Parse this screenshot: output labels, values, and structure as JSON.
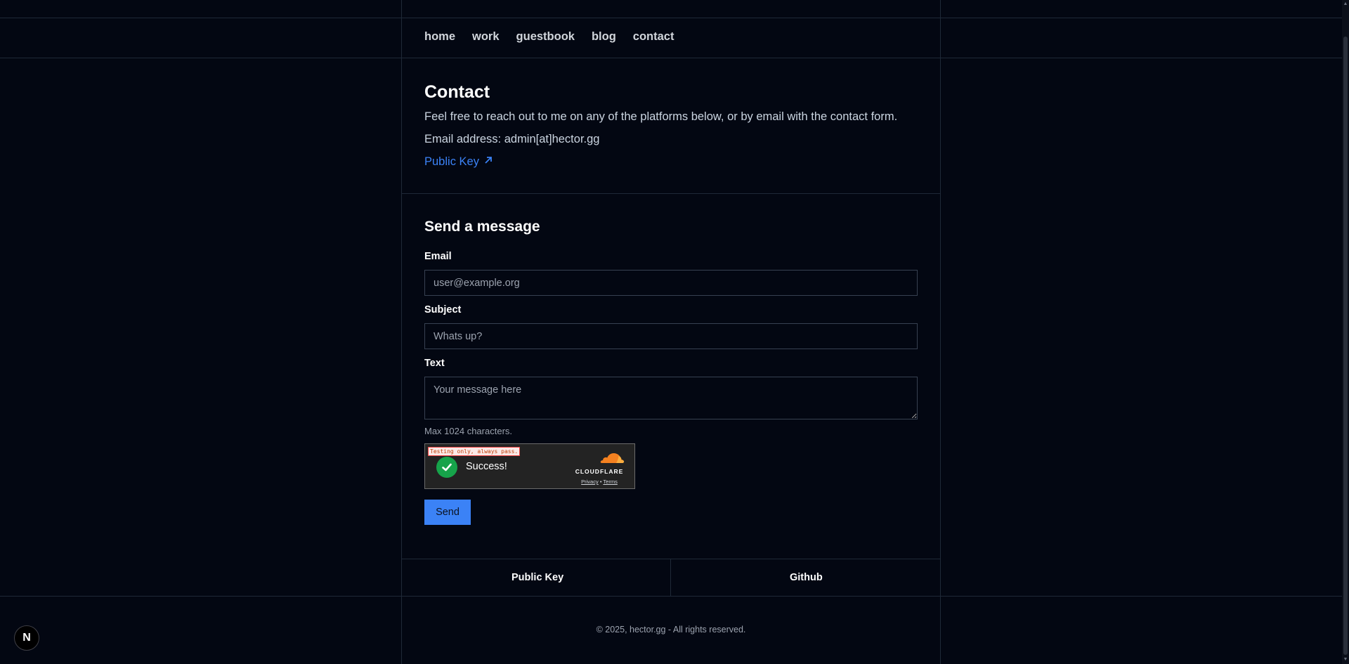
{
  "nav": {
    "items": [
      {
        "label": "home"
      },
      {
        "label": "work"
      },
      {
        "label": "guestbook"
      },
      {
        "label": "blog"
      },
      {
        "label": "contact"
      }
    ]
  },
  "contact": {
    "title": "Contact",
    "intro": "Feel free to reach out to me on any of the platforms below, or by email with the contact form.",
    "email_line": "Email address: admin[at]hector.gg",
    "public_key_label": "Public Key"
  },
  "form": {
    "title": "Send a message",
    "email_label": "Email",
    "email_placeholder": "user@example.org",
    "subject_label": "Subject",
    "subject_placeholder": "Whats up?",
    "text_label": "Text",
    "text_placeholder": "Your message here",
    "hint": "Max 1024 characters.",
    "send_label": "Send"
  },
  "captcha": {
    "testing_note": "Testing only, always pass.",
    "status": "Success!",
    "brand": "CLOUDFLARE",
    "privacy": "Privacy",
    "separator": "•",
    "terms": "Terms"
  },
  "footer": {
    "links": [
      {
        "label": "Public Key"
      },
      {
        "label": "Github"
      }
    ],
    "copyright": "© 2025, hector.gg - All rights reserved."
  },
  "badge": {
    "letter": "N"
  },
  "colors": {
    "background": "#030712",
    "accent": "#3b82f6",
    "border": "#1f2937",
    "success": "#16a34a"
  }
}
